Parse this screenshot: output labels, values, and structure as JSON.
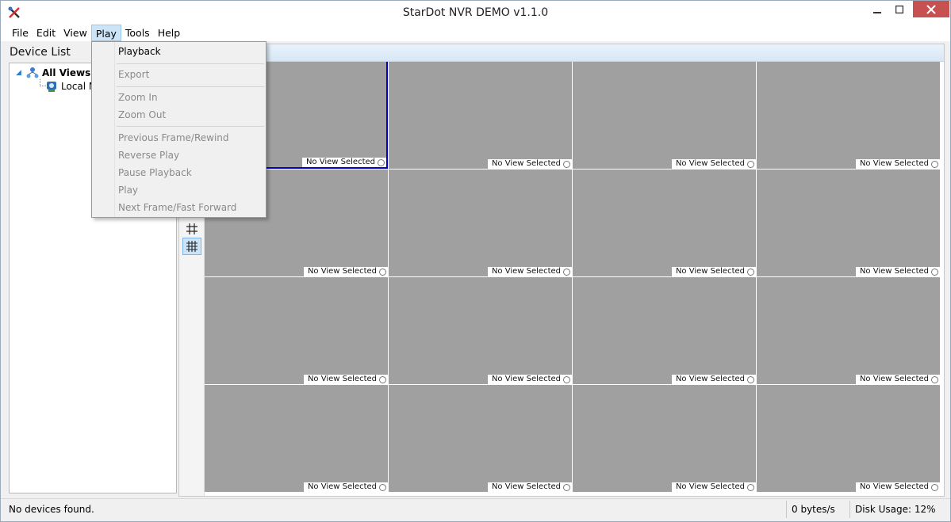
{
  "window": {
    "title": "StarDot NVR DEMO v1.1.0"
  },
  "menubar": {
    "items": [
      "File",
      "Edit",
      "View",
      "Play",
      "Tools",
      "Help"
    ],
    "active": "Play"
  },
  "play_menu": {
    "items": [
      {
        "label": "Playback",
        "enabled": true
      },
      {
        "label": "Export",
        "enabled": false
      },
      {
        "label": "Zoom In",
        "enabled": false
      },
      {
        "label": "Zoom Out",
        "enabled": false
      },
      {
        "label": "Previous Frame/Rewind",
        "enabled": false
      },
      {
        "label": "Reverse Play",
        "enabled": false
      },
      {
        "label": "Pause Playback",
        "enabled": false
      },
      {
        "label": "Play",
        "enabled": false
      },
      {
        "label": "Next Frame/Fast Forward",
        "enabled": false
      }
    ]
  },
  "device_panel": {
    "title": "Device List",
    "tree": {
      "root": "All Views",
      "child": "Local N"
    }
  },
  "view_grid": {
    "rows": 4,
    "cols": 4,
    "cell_label": "No View Selected"
  },
  "statusbar": {
    "message": "No devices found.",
    "rate": "0 bytes/s",
    "disk": "Disk Usage: 12%"
  },
  "colors": {
    "cell_bg": "#a0a0a0",
    "selection_border": "#0000c8",
    "menu_highlight": "#cce4f7",
    "close_button": "#c75050"
  }
}
